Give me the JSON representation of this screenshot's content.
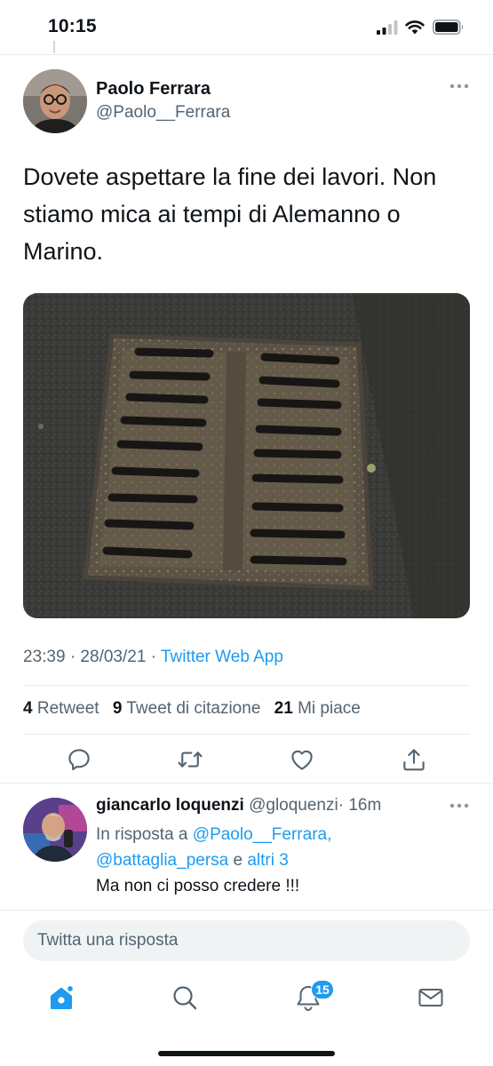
{
  "status_bar": {
    "time": "10:15"
  },
  "tweet": {
    "author_name": "Paolo Ferrara",
    "author_handle": "@Paolo__Ferrara",
    "text": "Dovete aspettare la fine dei lavori. Non stiamo mica ai tempi di Alemanno o Marino.",
    "image_description": "drain-grate-photo",
    "timestamp": "23:39 · 28/03/21 · ",
    "source": "Twitter Web App",
    "stats": {
      "retweets_count": "4",
      "retweets_label": "Retweet",
      "quotes_count": "9",
      "quotes_label": "Tweet di citazione",
      "likes_count": "21",
      "likes_label": "Mi piace"
    },
    "actions": [
      "reply-icon",
      "retweet-icon",
      "like-icon",
      "share-icon"
    ]
  },
  "reply": {
    "author_name": "giancarlo loquenzi",
    "author_handle": "@gloquenzi",
    "time": "· 16m",
    "reply_prefix": "In risposta a ",
    "mention_1": "@Paolo__Ferrara,",
    "mention_2": "@battaglia_persa",
    "reply_and": " e ",
    "reply_others": "altri 3",
    "text": "Ma non ci posso credere !!!"
  },
  "composer": {
    "placeholder": "Twitta una risposta"
  },
  "tab_bar": {
    "items": [
      "home-icon",
      "search-icon",
      "notifications-icon",
      "messages-icon"
    ],
    "notifications_badge": "15"
  },
  "colors": {
    "accent": "#1d9bf0",
    "text": "#0f1419",
    "secondary": "#536471",
    "divider": "#e6ecf0"
  }
}
